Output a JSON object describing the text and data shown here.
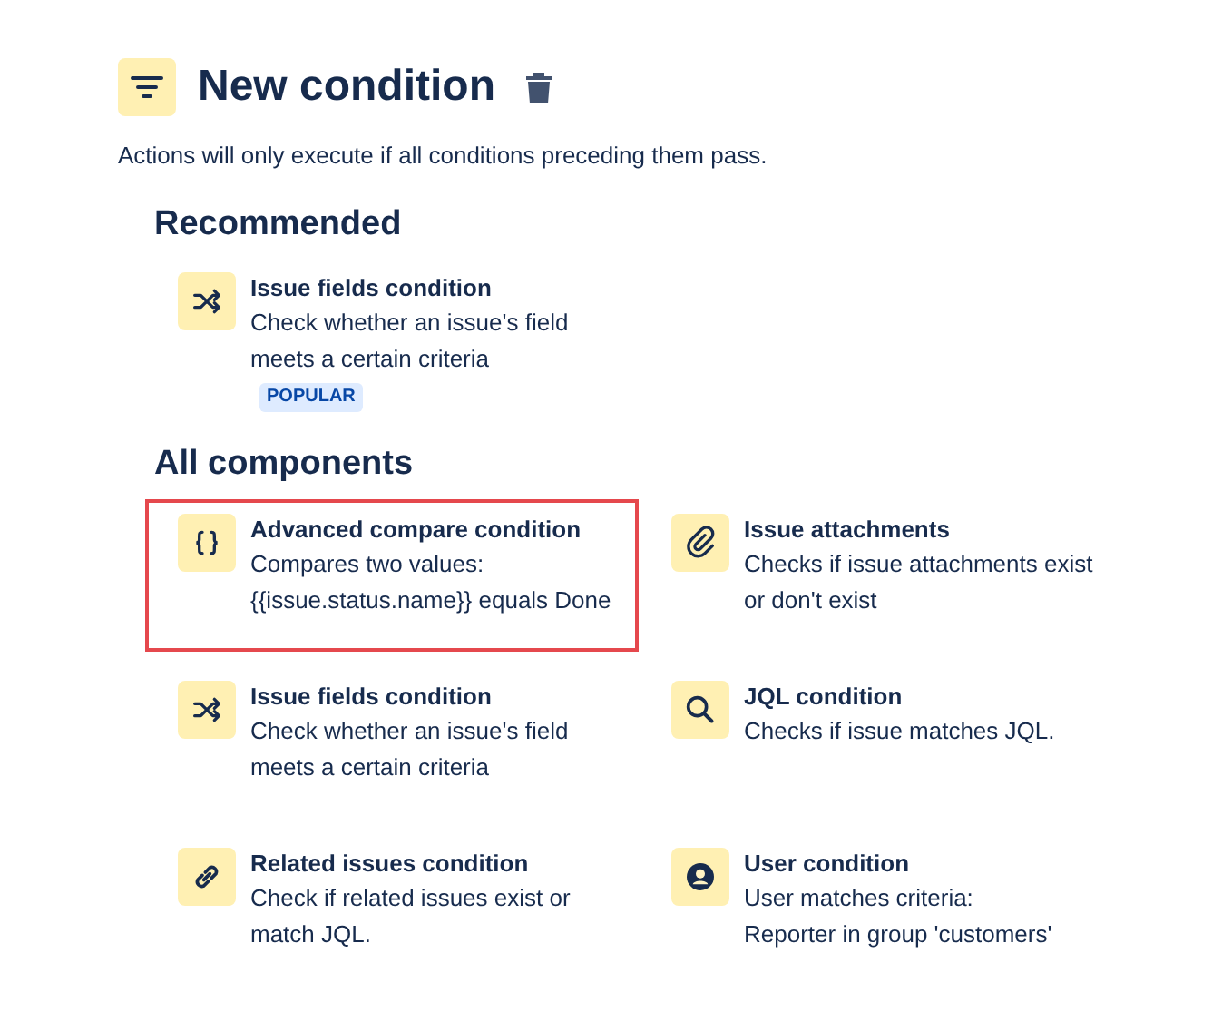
{
  "header": {
    "title": "New condition",
    "subtitle": "Actions will only execute if all conditions preceding them pass."
  },
  "sections": [
    {
      "heading": "Recommended",
      "items": [
        {
          "kind": "shuffle",
          "title": "Issue fields condition",
          "description_lines": [
            "Check whether an issue's field",
            "meets a certain criteria"
          ],
          "badge": "POPULAR",
          "highlighted": false
        }
      ]
    },
    {
      "heading": "All components",
      "items": [
        {
          "kind": "braces",
          "title": "Advanced compare condition",
          "description_lines": [
            "Compares two values:",
            "{{issue.status.name}} equals Done"
          ],
          "highlighted": true
        },
        {
          "kind": "paperclip",
          "title": "Issue attachments",
          "description_lines": [
            "Checks if issue attachments exist",
            "or don't exist"
          ],
          "highlighted": false
        },
        {
          "kind": "shuffle",
          "title": "Issue fields condition",
          "description_lines": [
            "Check whether an issue's field",
            "meets a certain criteria"
          ],
          "highlighted": false
        },
        {
          "kind": "search",
          "title": "JQL condition",
          "description_lines": [
            "Checks if issue matches JQL."
          ],
          "highlighted": false
        },
        {
          "kind": "link",
          "title": "Related issues condition",
          "description_lines": [
            "Check if related issues exist or",
            "match JQL."
          ],
          "highlighted": false
        },
        {
          "kind": "user",
          "title": "User condition",
          "description_lines": [
            "User matches criteria:",
            "Reporter in group 'customers'"
          ],
          "highlighted": false
        }
      ]
    }
  ]
}
